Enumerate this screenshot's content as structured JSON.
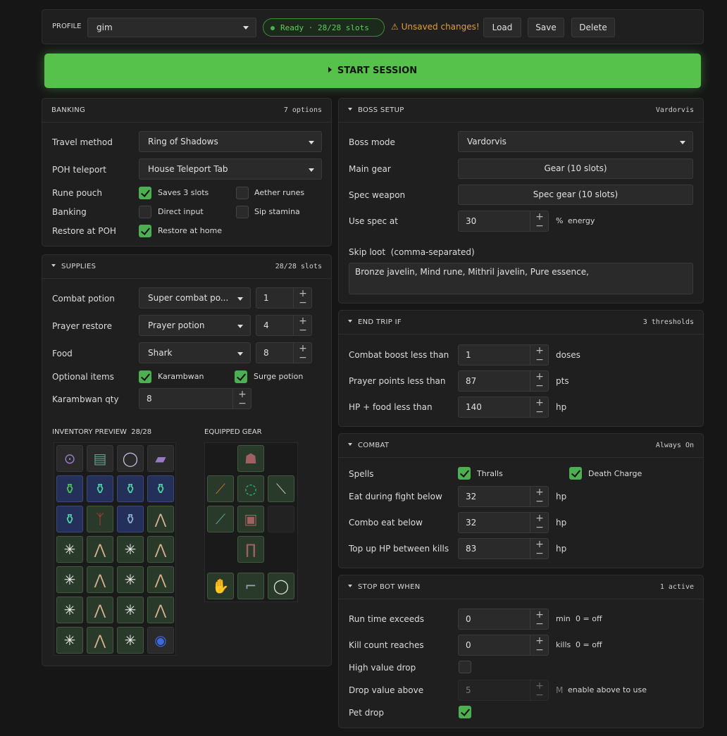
{
  "profile": {
    "label": "PROFILE",
    "value": "gim",
    "status": "Ready · 28/28 slots",
    "warning": "⚠ Unsaved changes!",
    "load": "Load",
    "save": "Save",
    "delete": "Delete"
  },
  "start": "START SESSION",
  "banking": {
    "title": "BANKING",
    "meta": "7 options",
    "travel_label": "Travel method",
    "travel_value": "Ring of Shadows",
    "poh_label": "POH teleport",
    "poh_value": "House Teleport Tab",
    "rune_label": "Rune pouch",
    "rune_opt1": "Saves 3 slots",
    "rune_opt2": "Aether runes",
    "bank_label": "Banking",
    "bank_opt1": "Direct input",
    "bank_opt2": "Sip stamina",
    "restore_label": "Restore at POH",
    "restore_opt": "Restore at home"
  },
  "supplies": {
    "title": "SUPPLIES",
    "meta": "28/28 slots",
    "combat_label": "Combat potion",
    "combat_value": "Super combat po...",
    "combat_qty": "1",
    "prayer_label": "Prayer restore",
    "prayer_value": "Prayer potion",
    "prayer_qty": "4",
    "food_label": "Food",
    "food_value": "Shark",
    "food_qty": "8",
    "optional_label": "Optional items",
    "opt1": "Karambwan",
    "opt2": "Surge potion",
    "karam_label": "Karambwan qty",
    "karam_qty": "8",
    "inv_title": "INVENTORY PREVIEW",
    "inv_count": "28/28",
    "eq_title": "EQUIPPED GEAR"
  },
  "boss": {
    "title": "BOSS SETUP",
    "meta": "Vardorvis",
    "mode_label": "Boss mode",
    "mode_value": "Vardorvis",
    "gear_label": "Main gear",
    "gear_value": "Gear (10 slots)",
    "spec_label": "Spec weapon",
    "spec_value": "Spec gear (10 slots)",
    "usespec_label": "Use spec at",
    "usespec_value": "30",
    "usespec_unit1": "%",
    "usespec_unit2": "energy",
    "skip_label": "Skip loot",
    "skip_hint": "(comma-separated)",
    "skip_value": "Bronze javelin, Mind rune, Mithril javelin, Pure essence,"
  },
  "endtrip": {
    "title": "END TRIP IF",
    "meta": "3 thresholds",
    "r1_label": "Combat boost less than",
    "r1_value": "1",
    "r1_unit": "doses",
    "r2_label": "Prayer points less than",
    "r2_value": "87",
    "r2_unit": "pts",
    "r3_label": "HP + food less than",
    "r3_value": "140",
    "r3_unit": "hp"
  },
  "combat": {
    "title": "COMBAT",
    "meta": "Always On",
    "spells_label": "Spells",
    "spell1": "Thralls",
    "spell2": "Death Charge",
    "eat_label": "Eat during fight below",
    "eat_value": "32",
    "eat_unit": "hp",
    "combo_label": "Combo eat below",
    "combo_value": "32",
    "combo_unit": "hp",
    "topup_label": "Top up HP between kills",
    "topup_value": "83",
    "topup_unit": "hp"
  },
  "stop": {
    "title": "STOP BOT WHEN",
    "meta": "1 active",
    "run_label": "Run time exceeds",
    "run_value": "0",
    "run_unit": "min",
    "run_hint": "0 = off",
    "kill_label": "Kill count reaches",
    "kill_value": "0",
    "kill_unit": "kills",
    "kill_hint": "0 = off",
    "hv_label": "High value drop",
    "dv_label": "Drop value above",
    "dv_value": "5",
    "dv_unit": "M",
    "dv_hint": "enable above to use",
    "pet_label": "Pet drop"
  },
  "colors": {
    "accent": "#4caf50",
    "start_bg": "#56c24c",
    "warning": "#e0a030"
  }
}
